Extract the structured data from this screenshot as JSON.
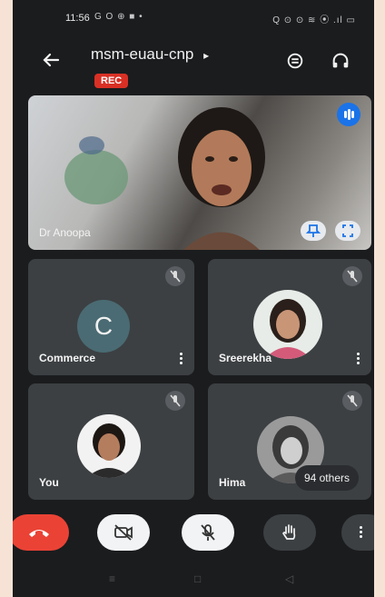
{
  "status_bar": {
    "time": "11:56",
    "left_icons": "G O ⊕ ■ •",
    "right_icons": "Q ⊙ ⊙ ≋ ⦿ .ıl ▭"
  },
  "header": {
    "meeting_code": "msm-euau-cnp",
    "meeting_arrow": "▸",
    "rec_label": "REC"
  },
  "main_tile": {
    "name": "Dr Anoopa"
  },
  "tiles": [
    {
      "name": "Commerce",
      "initial": "C"
    },
    {
      "name": "Sreerekha"
    },
    {
      "name": "You"
    },
    {
      "name": "Hima",
      "others_label": "94 others"
    }
  ],
  "colors": {
    "end_call": "#ea4335",
    "rec": "#d93025",
    "accent": "#1a73e8",
    "tile": "#3c4043"
  },
  "controls": [
    "end-call-icon",
    "camera-off-icon",
    "mic-off-icon",
    "raise-hand-icon",
    "more-options-icon"
  ],
  "nav": {
    "back": "◁",
    "home": "□",
    "recents": "≡"
  }
}
